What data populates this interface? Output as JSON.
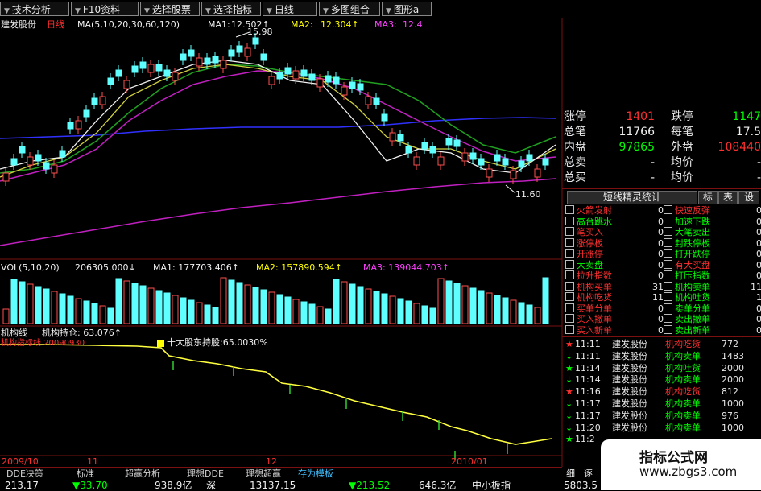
{
  "toolbar": {
    "items": [
      {
        "label": "技术分析"
      },
      {
        "label": "F10资料"
      },
      {
        "label": "选择股票"
      },
      {
        "label": "选择指标"
      },
      {
        "label": "日线"
      },
      {
        "label": "多图组合"
      },
      {
        "label": "图形a"
      }
    ]
  },
  "main_chart": {
    "stock_name": "建发股份",
    "period": "日线",
    "ma_params": "MA(5,10,20,30,60,120)",
    "ma1_label": "MA1:",
    "ma1_value": "12.502↑",
    "ma2_label": "MA2:",
    "ma2_value": "12.304↑",
    "ma3_label": "MA3:",
    "ma3_value": "12.4",
    "high_marker": "15.98",
    "low_marker": "11.60"
  },
  "volume_chart": {
    "params": "VOL(5,10,20)",
    "vol_value": "206305.000↓",
    "ma1": "MA1: 177703.406↑",
    "ma2": "MA2: 157890.594↑",
    "ma3": "MA3: 139044.703↑"
  },
  "inst_chart": {
    "title": "机构线",
    "holding": "机构持仓: 63.076↑",
    "red_label": "机构指标线 20090930",
    "legend": "十大股东持股:65.0030%"
  },
  "axis": {
    "labels": [
      "2009/10",
      "11",
      "12",
      "2010/01"
    ]
  },
  "quote": {
    "rows": [
      {
        "l1": "涨停",
        "v1": "1401",
        "l2": "跌停",
        "v2": "1147",
        "v1c": "#ff3030",
        "v2c": "#00ff00"
      },
      {
        "l1": "总笔",
        "v1": "11766",
        "l2": "每笔",
        "v2": "17.5",
        "v1c": "#f0f0f0",
        "v2c": "#f0f0f0"
      },
      {
        "l1": "内盘",
        "v1": "97865",
        "l2": "外盘",
        "v2": "108440",
        "v1c": "#00ff00",
        "v2c": "#ff3030"
      },
      {
        "l1": "总卖",
        "v1": "-",
        "l2": "均价",
        "v2": "-",
        "v1c": "#f0f0f0",
        "v2c": "#f0f0f0"
      },
      {
        "l1": "总买",
        "v1": "-",
        "l2": "均价",
        "v2": "-",
        "v1c": "#f0f0f0",
        "v2c": "#f0f0f0"
      }
    ]
  },
  "stats": {
    "title": "短线精灵统计",
    "tabs": [
      "标",
      "表",
      "设"
    ],
    "left": [
      {
        "label": "火箭发射",
        "val": "0",
        "c": "#ff3030"
      },
      {
        "label": "高台跳水",
        "val": "0",
        "c": "#00ff00"
      },
      {
        "label": "笔买入",
        "val": "0",
        "c": "#ff3030"
      },
      {
        "label": "涨停板",
        "val": "0",
        "c": "#ff3030"
      },
      {
        "label": "开涨停",
        "val": "0",
        "c": "#ff3030"
      },
      {
        "label": "大卖盘",
        "val": "0",
        "c": "#00ff00"
      },
      {
        "label": "拉升指数",
        "val": "0",
        "c": "#ff3030"
      },
      {
        "label": "机构买单",
        "val": "31",
        "c": "#ff3030"
      },
      {
        "label": "机构吃货",
        "val": "11",
        "c": "#ff3030"
      },
      {
        "label": "买单分单",
        "val": "0",
        "c": "#ff3030"
      },
      {
        "label": "买入撤单",
        "val": "0",
        "c": "#ff3030"
      },
      {
        "label": "买入新单",
        "val": "0",
        "c": "#ff3030"
      }
    ],
    "right": [
      {
        "label": "快速反弹",
        "val": "0",
        "c": "#ff3030"
      },
      {
        "label": "加速下跌",
        "val": "0",
        "c": "#00ff00"
      },
      {
        "label": "大笔卖出",
        "val": "0",
        "c": "#00ff00"
      },
      {
        "label": "封跌停板",
        "val": "0",
        "c": "#00ff00"
      },
      {
        "label": "打开跌停",
        "val": "0",
        "c": "#00ff00"
      },
      {
        "label": "有大买盘",
        "val": "0",
        "c": "#ff3030"
      },
      {
        "label": "打压指数",
        "val": "0",
        "c": "#00ff00"
      },
      {
        "label": "机构卖单",
        "val": "11",
        "c": "#00ff00"
      },
      {
        "label": "机构吐货",
        "val": "1",
        "c": "#00ff00"
      },
      {
        "label": "卖单分单",
        "val": "0",
        "c": "#00ff00"
      },
      {
        "label": "卖出撤单",
        "val": "0",
        "c": "#00ff00"
      },
      {
        "label": "卖出新单",
        "val": "0",
        "c": "#00ff00"
      }
    ]
  },
  "ticks": [
    {
      "sym": "★",
      "time": "11:11",
      "name": "建发股份",
      "type": "机构吃货",
      "val": "772",
      "c": "#ff3030"
    },
    {
      "sym": "↓",
      "time": "11:11",
      "name": "建发股份",
      "type": "机构卖单",
      "val": "1483",
      "c": "#00ff00"
    },
    {
      "sym": "★",
      "time": "11:14",
      "name": "建发股份",
      "type": "机构吐货",
      "val": "2000",
      "c": "#00ff00"
    },
    {
      "sym": "↓",
      "time": "11:14",
      "name": "建发股份",
      "type": "机构卖单",
      "val": "2000",
      "c": "#00ff00"
    },
    {
      "sym": "★",
      "time": "11:16",
      "name": "建发股份",
      "type": "机构吃货",
      "val": "812",
      "c": "#ff3030"
    },
    {
      "sym": "↓",
      "time": "11:17",
      "name": "建发股份",
      "type": "机构卖单",
      "val": "1000",
      "c": "#00ff00"
    },
    {
      "sym": "↓",
      "time": "11:17",
      "name": "建发股份",
      "type": "机构卖单",
      "val": "976",
      "c": "#00ff00"
    },
    {
      "sym": "↓",
      "time": "11:20",
      "name": "建发股份",
      "type": "机构卖单",
      "val": "1000",
      "c": "#00ff00"
    },
    {
      "sym": "★",
      "time": "11:2",
      "name": "",
      "type": "",
      "val": "",
      "c": "#00ff00"
    }
  ],
  "bottom": {
    "tabs": [
      "DDE决策",
      "标准",
      "超赢分析",
      "理想DDE",
      "理想超赢",
      "存为模板"
    ],
    "values": [
      {
        "text": "213.17",
        "c": "#f0f0f0"
      },
      {
        "text": "▼33.70",
        "c": "#00ff00"
      },
      {
        "text": "938.9亿",
        "c": "#f0f0f0"
      },
      {
        "text": "深",
        "c": "#f0f0f0"
      },
      {
        "text": "13137.15",
        "c": "#f0f0f0"
      },
      {
        "text": "▼213.52",
        "c": "#00ff00"
      },
      {
        "text": "646.3亿",
        "c": "#f0f0f0"
      },
      {
        "text": "中小板指",
        "c": "#f0f0f0"
      },
      {
        "text": "5803.5",
        "c": "#f0f0f0"
      }
    ],
    "side_btns": [
      "细",
      "逐"
    ]
  },
  "watermark": {
    "line1": "指标公式网",
    "line2": "www.zbgs3.com"
  }
}
